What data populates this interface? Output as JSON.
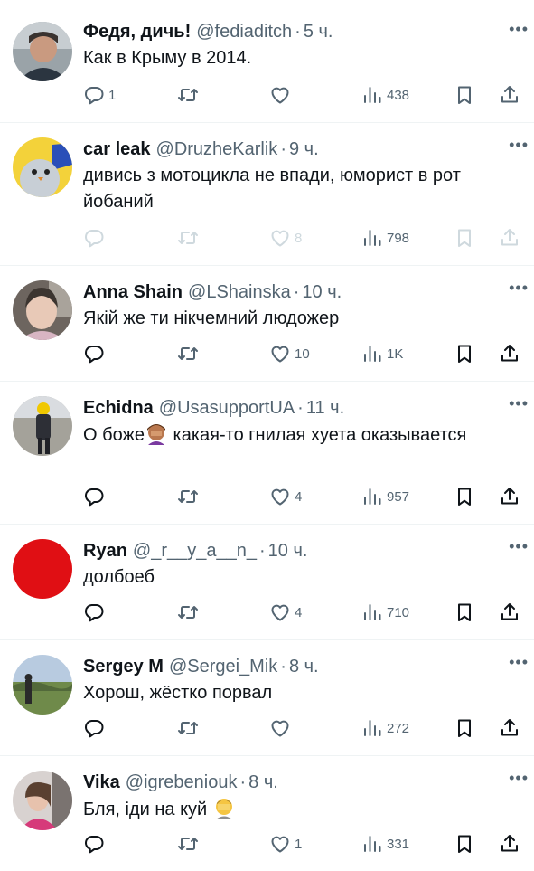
{
  "colors": {
    "text": "#0f1419",
    "muted": "#536471",
    "divider": "#eff3f4",
    "faded": "#cfd9de"
  },
  "icons": {
    "reply": "reply-icon",
    "retweet": "retweet-icon",
    "like": "heart-icon",
    "views": "views-icon",
    "bookmark": "bookmark-icon",
    "share": "share-icon",
    "more": "more-icon"
  },
  "tweets": [
    {
      "name": "Федя, дичь!",
      "handle": "@fediaditch",
      "sep": "·",
      "time": "5 ч.",
      "text": "Как в Крыму в 2014.",
      "replies": "1",
      "retweets": "",
      "likes": "",
      "views": "438"
    },
    {
      "name": "car leak",
      "handle": "@DruzheKarlik",
      "sep": "·",
      "time": "9 ч.",
      "text": "дивись з мотоцикла не впади, юморист в рот йобаний",
      "replies": "",
      "retweets": "",
      "likes": "8",
      "views": "798"
    },
    {
      "name": "Anna Shain",
      "handle": "@LShainska",
      "sep": "·",
      "time": "10 ч.",
      "text": "Якій же ти нікчемний людожер",
      "replies": "",
      "retweets": "",
      "likes": "10",
      "views": "1K"
    },
    {
      "name": "Echidna",
      "handle": "@UsasupportUA",
      "sep": "·",
      "time": "11 ч.",
      "text_before": "О боже",
      "text_after": " какая-то гнилая хуета оказывается",
      "replies": "",
      "retweets": "",
      "likes": "4",
      "views": "957"
    },
    {
      "name": "Ryan",
      "handle": "@_r__y_a__n_",
      "sep": "·",
      "time": "10 ч.",
      "text": "долбоеб",
      "replies": "",
      "retweets": "",
      "likes": "4",
      "views": "710"
    },
    {
      "name": "Sergey M",
      "handle": "@Sergei_Mik",
      "sep": "·",
      "time": "8 ч.",
      "text": "Хорош, жёстко порвал",
      "replies": "",
      "retweets": "",
      "likes": "",
      "views": "272"
    },
    {
      "name": "Vika",
      "handle": "@igrebeniouk",
      "sep": "·",
      "time": "8 ч.",
      "text": "Бля, іди на куй",
      "replies": "",
      "retweets": "",
      "likes": "1",
      "views": "331"
    }
  ]
}
